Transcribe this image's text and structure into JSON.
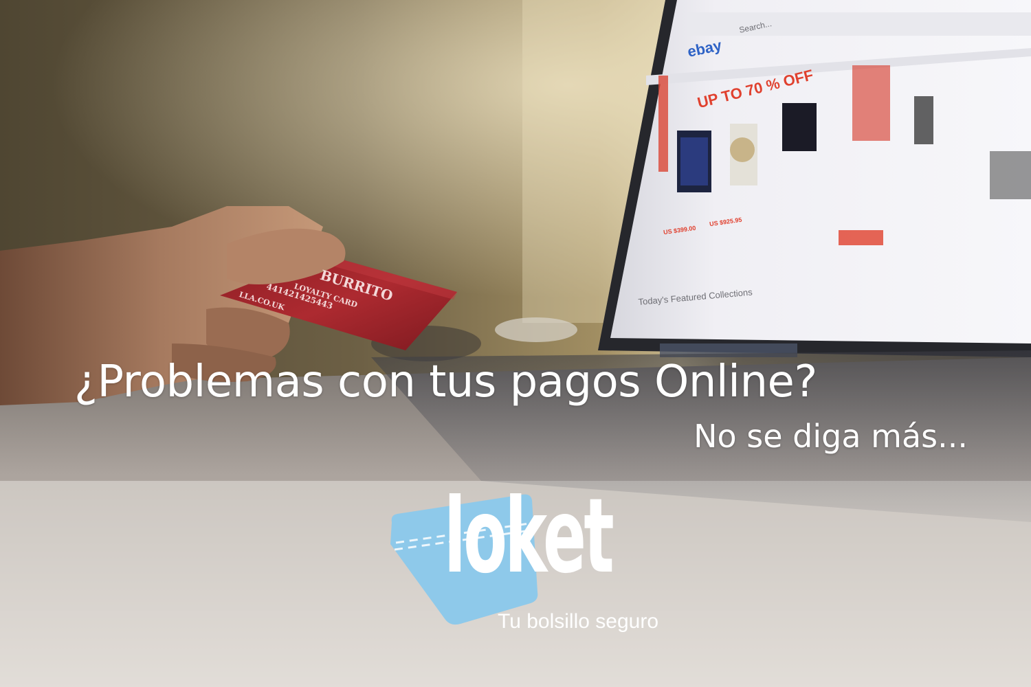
{
  "headline": "¿Problemas con tus pagos Online?",
  "subheadline": "No se diga más...",
  "logo": {
    "wordmark": "loket",
    "tagline": "Tu bolsillo seguro",
    "badge_color": "#8ec9ea"
  },
  "credit_card": {
    "brand": "BURRITO",
    "line": "LOYALTY CARD",
    "number": "441421425443",
    "website": "LLA.CO.UK",
    "color": "#a3262b"
  },
  "laptop_screen": {
    "store_logo": "ebay",
    "search_label": "Search...",
    "promo_text": "UP TO 70 % OFF",
    "section_title": "Today's Featured Collections",
    "price_1": "US $399.00",
    "price_2": "US $925.95"
  }
}
